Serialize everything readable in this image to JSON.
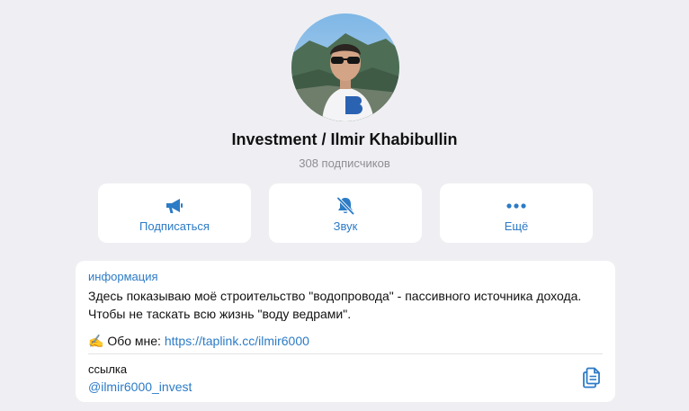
{
  "profile": {
    "name": "Investment / Ilmir Khabibullin",
    "subscribers": "308 подписчиков"
  },
  "actions": {
    "subscribe_label": "Подписаться",
    "sound_label": "Звук",
    "more_label": "Ещё"
  },
  "info": {
    "title": "информация",
    "description": "Здесь показываю моё строительство \"водопровода\" - пассивного источника дохода. Чтобы не таскать всю жизнь \"воду ведрами\".",
    "about_emoji": "✍️",
    "about_prefix": "Обо мне:",
    "about_link": "https://taplink.cc/ilmir6000",
    "link_title": "ссылка",
    "link_value": "@ilmir6000_invest"
  },
  "icons": {
    "subscribe": "megaphone-icon",
    "sound": "bell-slash-icon",
    "more": "ellipsis-icon",
    "copy": "copy-icon"
  },
  "colors": {
    "accent": "#2c7bc6",
    "background": "#efeff3",
    "card": "#ffffff",
    "muted": "#8e8e93"
  }
}
